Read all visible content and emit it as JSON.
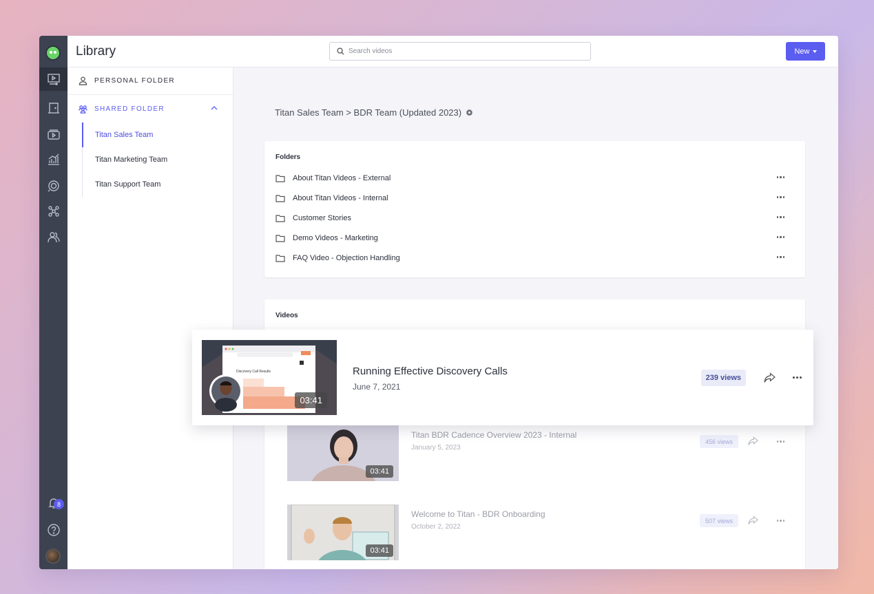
{
  "app": {
    "title": "Library"
  },
  "search": {
    "placeholder": "Search videos"
  },
  "toolbar": {
    "new_label": "New"
  },
  "rail": {
    "notification_count": "8"
  },
  "sidebar": {
    "personal_label": "PERSONAL FOLDER",
    "shared_label": "SHARED FOLDER",
    "teams": [
      {
        "label": "Titan Sales Team"
      },
      {
        "label": "Titan Marketing Team"
      },
      {
        "label": "Titan Support Team"
      }
    ]
  },
  "breadcrumb": "Titan Sales Team > BDR Team (Updated 2023)",
  "folders": {
    "heading": "Folders",
    "items": [
      {
        "name": "About Titan Videos - External"
      },
      {
        "name": "About Titan Videos - Internal"
      },
      {
        "name": "Customer Stories"
      },
      {
        "name": "Demo Videos - Marketing"
      },
      {
        "name": "FAQ Video - Objection Handling"
      }
    ]
  },
  "videos": {
    "heading": "Videos",
    "featured": {
      "title": "Running Effective Discovery Calls",
      "date": "June 7, 2021",
      "views": "239 views",
      "duration": "03:41",
      "thumb_heading": "Discovery Call Results"
    },
    "items": [
      {
        "title": "Titan BDR Cadence Overview 2023 - Internal",
        "date": "January 5, 2023",
        "views": "456 views",
        "duration": "03:41"
      },
      {
        "title": "Welcome to Titan - BDR Onboarding",
        "date": "October 2, 2022",
        "views": "507 views",
        "duration": "03:41"
      }
    ]
  },
  "colors": {
    "accent": "#5b5cf0",
    "rail": "#3d4250"
  }
}
